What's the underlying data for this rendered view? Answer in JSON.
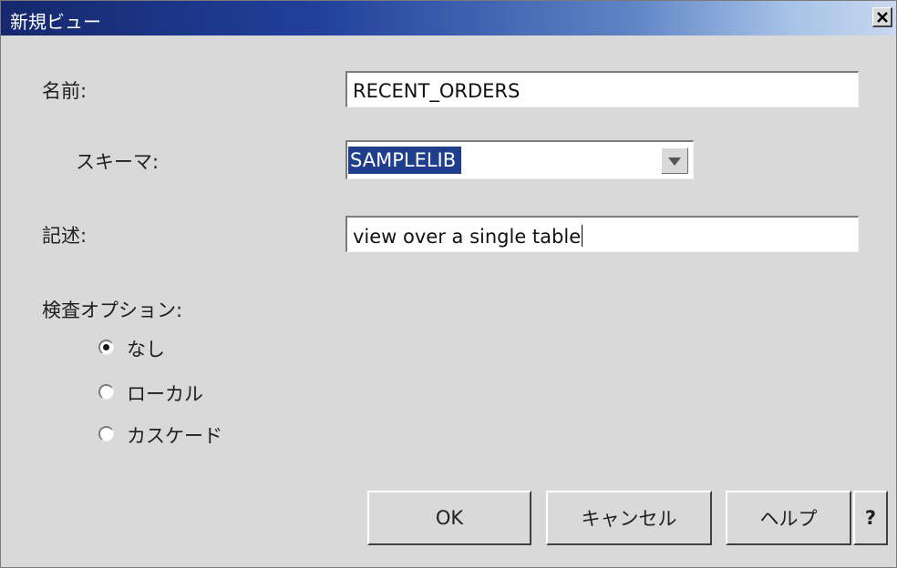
{
  "dialog": {
    "title": "新規ビュー",
    "close_symbol": "×"
  },
  "form": {
    "name_label": "名前:",
    "name_value": "RECENT_ORDERS",
    "schema_label": "スキーマ:",
    "schema_value": "SAMPLELIB",
    "description_label": "記述:",
    "description_value": "view over a single table",
    "check_options_label": "検査オプション:",
    "check_options": [
      {
        "label": "なし",
        "selected": true
      },
      {
        "label": "ローカル",
        "selected": false
      },
      {
        "label": "カスケード",
        "selected": false
      }
    ]
  },
  "buttons": {
    "ok": "OK",
    "cancel": "キャンセル",
    "help": "ヘルプ",
    "whats_this": "?"
  },
  "icons": {
    "close": "close-icon",
    "dropdown": "chevron-down-icon"
  }
}
